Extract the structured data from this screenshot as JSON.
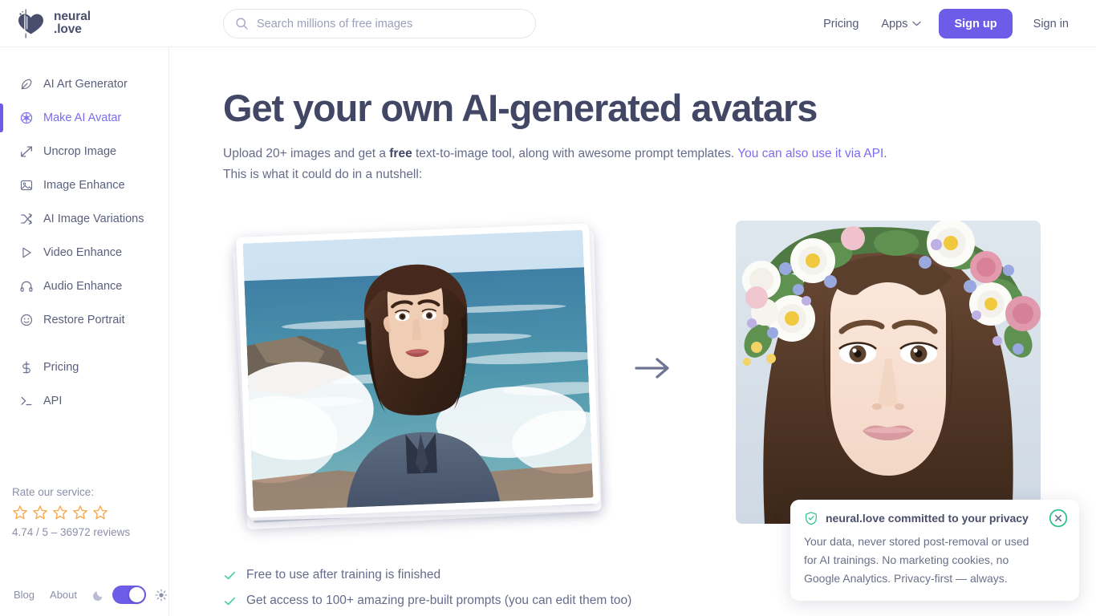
{
  "brand": {
    "name_line1": "neural",
    "name_line2": ".love",
    "logo_icon": "heart-logo-icon"
  },
  "search": {
    "placeholder": "Search millions of free images",
    "value": "",
    "icon": "search-icon"
  },
  "nav": {
    "pricing": "Pricing",
    "apps": "Apps",
    "apps_chevron_icon": "chevron-down-icon",
    "signup": "Sign up",
    "signin": "Sign in",
    "accent_color": "#6c5ce7"
  },
  "sidebar": {
    "items": [
      {
        "label": "AI Art Generator",
        "icon": "feather-pen-icon",
        "active": false
      },
      {
        "label": "Make AI Avatar",
        "icon": "aperture-icon",
        "active": true
      },
      {
        "label": "Uncrop Image",
        "icon": "expand-arrows-icon",
        "active": false
      },
      {
        "label": "Image Enhance",
        "icon": "image-icon",
        "active": false
      },
      {
        "label": "AI Image Variations",
        "icon": "shuffle-icon",
        "active": false
      },
      {
        "label": "Video Enhance",
        "icon": "play-triangle-icon",
        "active": false
      },
      {
        "label": "Audio Enhance",
        "icon": "headphones-icon",
        "active": false
      },
      {
        "label": "Restore Portrait",
        "icon": "smiley-face-icon",
        "active": false
      }
    ],
    "items2": [
      {
        "label": "Pricing",
        "icon": "dollar-sign-icon"
      },
      {
        "label": "API",
        "icon": "terminal-prompt-icon"
      }
    ],
    "rating": {
      "label": "Rate our service:",
      "stars": 5,
      "filled": 0,
      "star_color": "#f7a94c",
      "score_text": "4.74 / 5 – 36972 reviews"
    },
    "footer": {
      "blog": "Blog",
      "about": "About",
      "moon_icon": "moon-icon",
      "sun_icon": "sun-icon",
      "theme_toggle_on": true
    }
  },
  "main": {
    "heading": "Get your own AI-generated avatars",
    "sub_part1": "Upload 20+ images and get a ",
    "sub_bold": "free",
    "sub_part2": " text-to-image tool, along with awesome prompt templates. ",
    "sub_link": "You can also use it via API",
    "sub_part3": ".",
    "sub_line2": "This is what it could do in a nutshell:",
    "arrow_icon": "arrow-right-icon",
    "before_image_alt": "selfie of woman at the ocean coastline",
    "after_image_alt": "AI generated portrait of woman with flower crown",
    "checks": [
      {
        "label": "Free to use after training is finished",
        "icon": "check-icon"
      },
      {
        "label": "Get access to 100+ amazing pre-built prompts (you can edit them too)",
        "icon": "check-icon"
      }
    ],
    "check_color": "#3ecf8e"
  },
  "toast": {
    "shield_icon": "shield-check-icon",
    "close_icon": "close-circle-icon",
    "title": "neural.love committed to your privacy",
    "body": "Your data, never stored post-removal or used for AI trainings. No marketing cookies, no Google Analytics. Privacy-first — always.",
    "accent_color": "#27c08a"
  }
}
